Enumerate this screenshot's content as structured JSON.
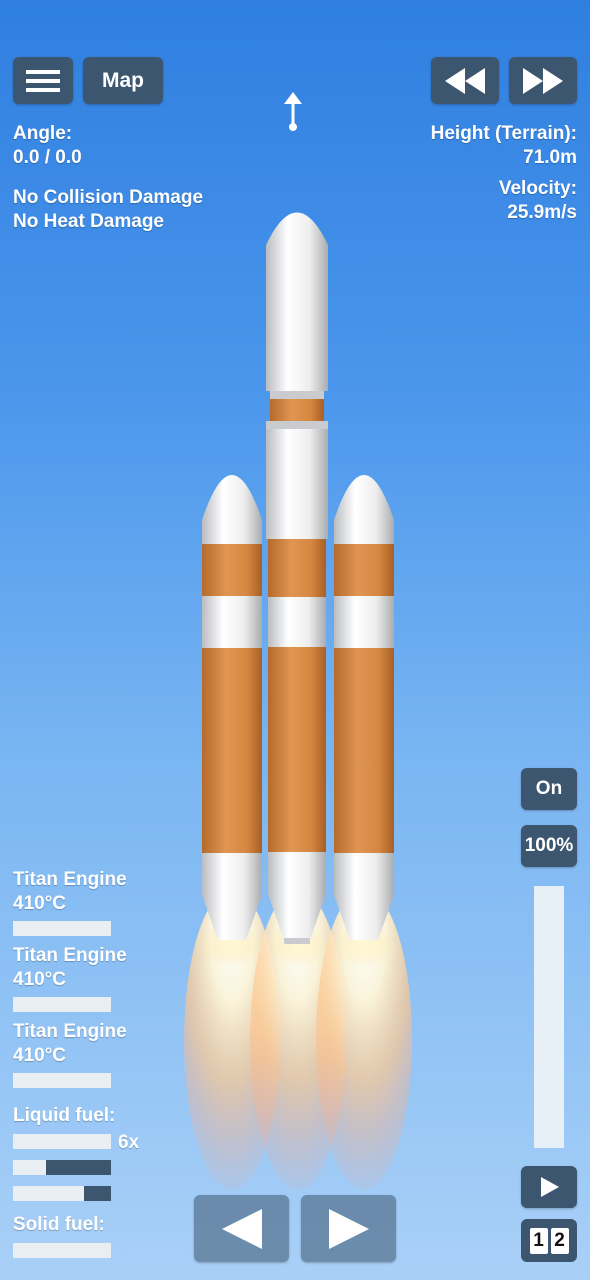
{
  "top_left": {
    "map_label": "Map",
    "angle_label": "Angle:",
    "angle_value": "0.0 / 0.0",
    "cheat1": "No Collision Damage",
    "cheat2": "No Heat Damage"
  },
  "top_right": {
    "height_label": "Height (Terrain):",
    "height_value": "71.0m",
    "velocity_label": "Velocity:",
    "velocity_value": "25.9m/s"
  },
  "engines": [
    {
      "name": "Titan Engine",
      "temp": "410°C",
      "heat_fraction": 0
    },
    {
      "name": "Titan Engine",
      "temp": "410°C",
      "heat_fraction": 0
    },
    {
      "name": "Titan Engine",
      "temp": "410°C",
      "heat_fraction": 0
    }
  ],
  "fuel": {
    "liquid_label": "Liquid fuel:",
    "liquid_multiplier": "6x",
    "liquid_bars": [
      1.0,
      0.34,
      0.72
    ],
    "solid_label": "Solid fuel:",
    "solid_bars": [
      1.0
    ]
  },
  "throttle": {
    "on_label": "On",
    "percent_label": "100%",
    "level": 1.0
  },
  "stage_digits": [
    "1",
    "2"
  ],
  "colors": {
    "button_bg": "#3d5670",
    "orange_tank": "#d98a45",
    "white_tank": "#f2f2f2"
  },
  "icons": [
    "menu-icon",
    "fast-backward-icon",
    "fast-forward-icon",
    "direction-arrow-icon",
    "play-icon",
    "rotate-left-icon",
    "rotate-right-icon"
  ]
}
